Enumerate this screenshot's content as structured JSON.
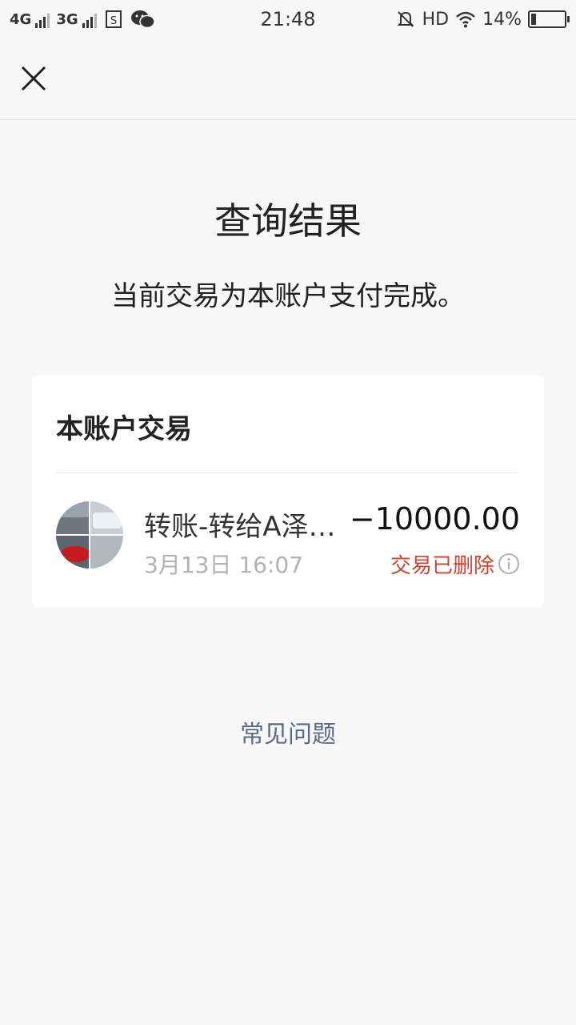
{
  "status_bar": {
    "network1": "4G",
    "network2": "3G",
    "time": "21:48",
    "hd_label": "HD",
    "battery_percent": "14%",
    "battery_level": 0.14,
    "icons": [
      "sim-icon",
      "wechat-icon",
      "mute-icon",
      "wifi-icon",
      "battery-icon"
    ]
  },
  "nav": {
    "close_icon": "close-icon"
  },
  "result": {
    "title": "查询结果",
    "description": "当前交易为本账户支付完成。"
  },
  "card": {
    "title": "本账户交易",
    "transaction": {
      "name": "转账-转给A泽…",
      "amount": "−10000.00",
      "time": "3月13日 16:07",
      "status": "交易已删除",
      "status_color": "#d0422f",
      "info_icon": "info-icon"
    }
  },
  "faq": {
    "label": "常见问题",
    "color": "#5a6b88"
  }
}
